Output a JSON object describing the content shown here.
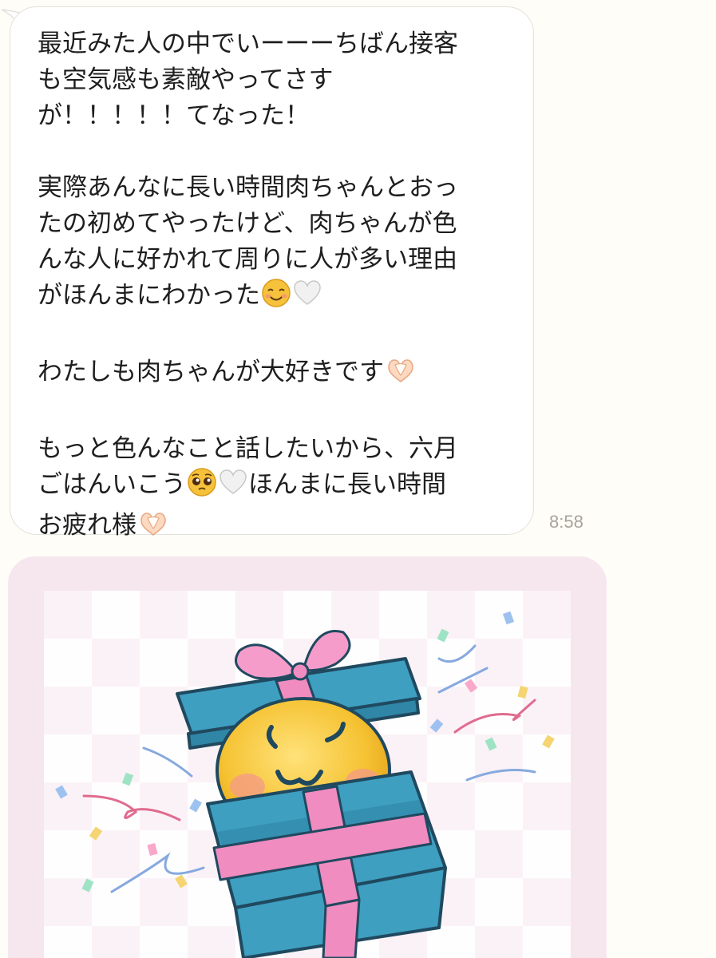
{
  "message": {
    "lines": [
      "最近みた人の中でいーーーちばん接客",
      "も空気感も素敵やってさす",
      "が！！！！！てなった！",
      "",
      "実際あんなに長い時間肉ちゃんとおっ",
      "たの初めてやったけど、肉ちゃんが色",
      "んな人に好かれて周りに人が多い理由",
      "がほんまにわかった",
      "",
      "わたしも肉ちゃんが大好きです",
      "",
      "もっと色んなこと話したいから、六月",
      "ごはんいこう",
      "お疲れ様"
    ],
    "line_12_after_emoji": "ほんまに長い時間",
    "emoji": {
      "line_8": [
        "smiling-face-icon",
        "white-heart-icon"
      ],
      "line_10": [
        "heart-hands-icon"
      ],
      "line_13": [
        "pleading-face-icon",
        "white-heart-icon"
      ],
      "line_14": [
        "heart-hands-icon"
      ]
    },
    "timestamp": "8:58"
  },
  "sticker": {
    "name": "gift-box-surprise-sticker",
    "background_color": "#f6e7ef",
    "box_color": "#3e9fc0",
    "ribbon_color": "#f08cc0",
    "face_color": "#f4c53a"
  }
}
